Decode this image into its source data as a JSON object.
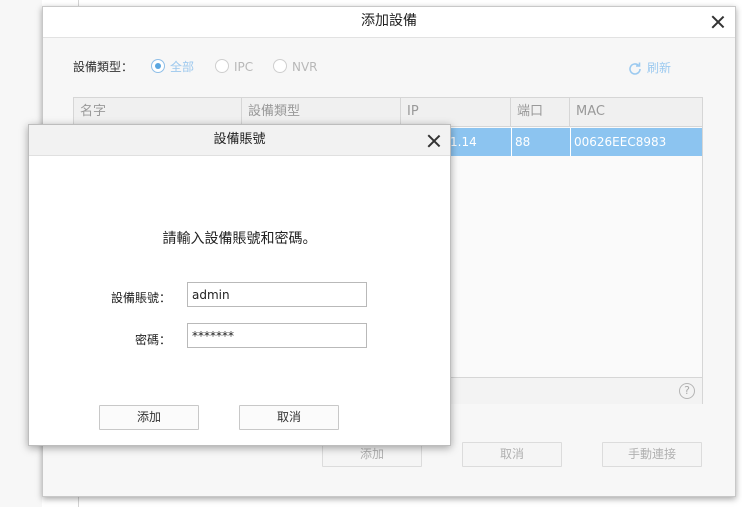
{
  "main_dialog": {
    "title": "添加設備",
    "device_type_label": "設備類型：",
    "radio_options": [
      {
        "label": "全部",
        "selected": true
      },
      {
        "label": "IPC",
        "selected": false
      },
      {
        "label": "NVR",
        "selected": false
      }
    ],
    "refresh_label": "刷新",
    "table": {
      "columns": [
        "名字",
        "設備類型",
        "IP",
        "端口",
        "MAC"
      ],
      "rows": [
        {
          "name": "",
          "type": "",
          "ip": "1.14",
          "port": "88",
          "mac": "00626EEC8983"
        }
      ]
    },
    "buttons": {
      "add": "添加",
      "cancel": "取消",
      "manual_connect": "手動連接"
    }
  },
  "account_dialog": {
    "title": "設備賬號",
    "prompt": "請輸入設備賬號和密碼。",
    "username_label": "設備賬號：",
    "username_value": "admin",
    "password_label": "密碼：",
    "password_value": "*******",
    "buttons": {
      "add": "添加",
      "cancel": "取消"
    }
  },
  "colors": {
    "selected_row": "#8cc4f0",
    "accent": "#5aa6e0"
  }
}
